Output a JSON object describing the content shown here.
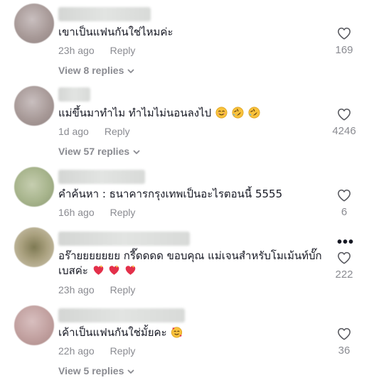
{
  "comments": [
    {
      "text": "เขาเป็นแฟนกันใช่ไหมค่ะ",
      "time": "23h ago",
      "reply_label": "Reply",
      "like_count": "169",
      "view_replies": "View 8 replies"
    },
    {
      "text": "แม่ขึ้นมาทำไม ทำไมไม่นอนลงไป",
      "time": "1d ago",
      "reply_label": "Reply",
      "like_count": "4246",
      "view_replies": "View 57 replies"
    },
    {
      "text": "คำค้นหา : ธนาคารกรุงเทพเป็นอะไรตอนนี้ 5555",
      "time": "16h ago",
      "reply_label": "Reply",
      "like_count": "6"
    },
    {
      "text_line1": "อร๊ายยยยยยย กรี๊ดดดด ขอบคุณ แม่เจนสำหรับโมเม้นท์บั๊ก",
      "text_line2": "เบสค่ะ",
      "time": "23h ago",
      "reply_label": "Reply",
      "like_count": "222",
      "more_label": "•••"
    },
    {
      "text": "เค้าเป็นแฟนกันใช่มั้ยคะ",
      "time": "22h ago",
      "reply_label": "Reply",
      "like_count": "36",
      "view_replies": "View 5 replies"
    }
  ],
  "icons": {
    "like": "heart-outline-icon",
    "expand": "chevron-down-icon",
    "more": "more-options-icon"
  },
  "colors": {
    "text": "#161823",
    "secondary": "#8a8b91"
  }
}
